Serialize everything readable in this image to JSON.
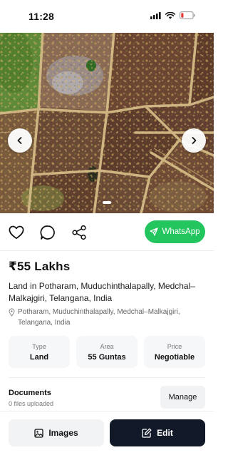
{
  "status_bar": {
    "time": "11:28",
    "icons": [
      "signal-icon",
      "wifi-icon",
      "battery-low-icon"
    ],
    "battery_color": "#e53935"
  },
  "hero": {
    "image_description_icon": "aerial-farmland-photo",
    "prev_icon": "chevron-left-icon",
    "next_icon": "chevron-right-icon",
    "slide_indicator_count": 1
  },
  "actions": {
    "icons": [
      "heart-icon",
      "chat-bubble-icon",
      "share-icon"
    ],
    "whatsapp_label": "WhatsApp",
    "whatsapp_icon": "send-icon",
    "whatsapp_color": "#22c55e"
  },
  "listing": {
    "price": "₹55 Lakhs",
    "title": "Land in Potharam, Muduchinthalapally, Medchal–Malkajgiri, Telangana, India",
    "location": "Potharam, Muduchinthalapally, Medchal–Malkajgiri, Telangana, India",
    "location_icon": "map-pin-icon"
  },
  "info_cards": [
    {
      "label": "Type",
      "value": "Land"
    },
    {
      "label": "Area",
      "value": "55 Guntas"
    },
    {
      "label": "Price",
      "value": "Negotiable"
    }
  ],
  "documents": {
    "title": "Documents",
    "subtitle": "0 files uploaded",
    "manage_label": "Manage"
  },
  "bottom_bar": {
    "images_label": "Images",
    "images_icon": "image-icon",
    "edit_label": "Edit",
    "edit_icon": "edit-icon",
    "edit_bg": "#111827"
  }
}
